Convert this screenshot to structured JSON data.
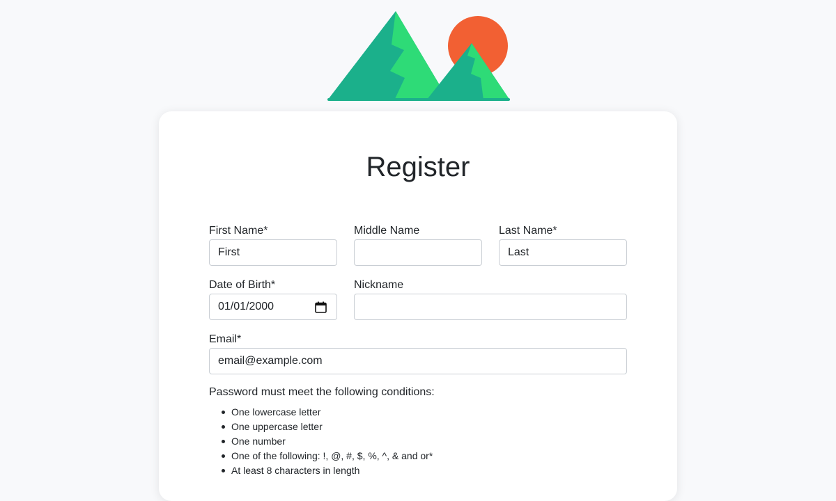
{
  "title": "Register",
  "fields": {
    "first_name": {
      "label": "First Name*",
      "value": "First"
    },
    "middle_name": {
      "label": "Middle Name",
      "value": ""
    },
    "last_name": {
      "label": "Last Name*",
      "value": "Last"
    },
    "date_of_birth": {
      "label": "Date of Birth*",
      "value": "01/01/2000"
    },
    "nickname": {
      "label": "Nickname",
      "value": ""
    },
    "email": {
      "label": "Email*",
      "value": "email@example.com"
    }
  },
  "password_rules": {
    "heading": "Password must meet the following conditions:",
    "items": [
      "One lowercase letter",
      "One uppercase letter",
      "One number",
      "One of the following: !, @, #, $, %, ^, & and or*",
      "At least 8 characters in length"
    ]
  },
  "colors": {
    "mountain_dark": "#1bb08b",
    "mountain_light": "#2edb77",
    "sun": "#f26033",
    "page_bg": "#f8f9fb"
  },
  "icons": {
    "logo": "mountains-sun-logo",
    "date_picker": "calendar-icon"
  }
}
